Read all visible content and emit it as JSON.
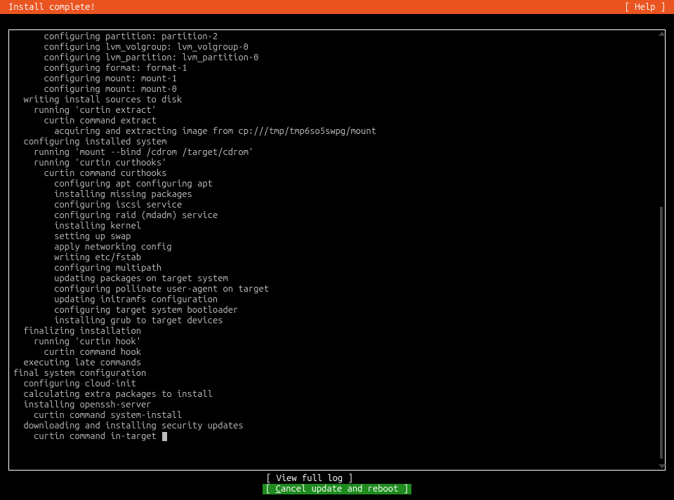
{
  "header": {
    "title": "Install complete!",
    "help": "[ Help ]"
  },
  "log": {
    "lines": [
      "      configuring partition: partition-2",
      "      configuring lvm_volgroup: lvm_volgroup-0",
      "      configuring lvm_partition: lvm_partition-0",
      "      configuring format: format-1",
      "      configuring mount: mount-1",
      "      configuring mount: mount-0",
      "  writing install sources to disk",
      "    running 'curtin extract'",
      "      curtin command extract",
      "        acquiring and extracting image from cp:///tmp/tmp6so5swpg/mount",
      "  configuring installed system",
      "    running 'mount --bind /cdrom /target/cdrom'",
      "    running 'curtin curthooks'",
      "      curtin command curthooks",
      "        configuring apt configuring apt",
      "        installing missing packages",
      "        configuring iscsi service",
      "        configuring raid (mdadm) service",
      "        installing kernel",
      "        setting up swap",
      "        apply networking config",
      "        writing etc/fstab",
      "        configuring multipath",
      "        updating packages on target system",
      "        configuring pollinate user-agent on target",
      "        updating initramfs configuration",
      "        configuring target system bootloader",
      "        installing grub to target devices",
      "  finalizing installation",
      "    running 'curtin hook'",
      "      curtin command hook",
      "  executing late commands",
      "final system configuration",
      "  configuring cloud-init",
      "  calculating extra packages to install",
      "  installing openssh-server",
      "    curtin command system-install",
      "  downloading and installing security updates",
      "    curtin command in-target"
    ]
  },
  "footer": {
    "view_log_prefix": "[ ",
    "view_log_label": "View full log",
    "view_log_suffix": "      ]",
    "cancel_prefix": "[ ",
    "cancel_hotkey": "C",
    "cancel_rest": "ancel update and reboot ]"
  }
}
